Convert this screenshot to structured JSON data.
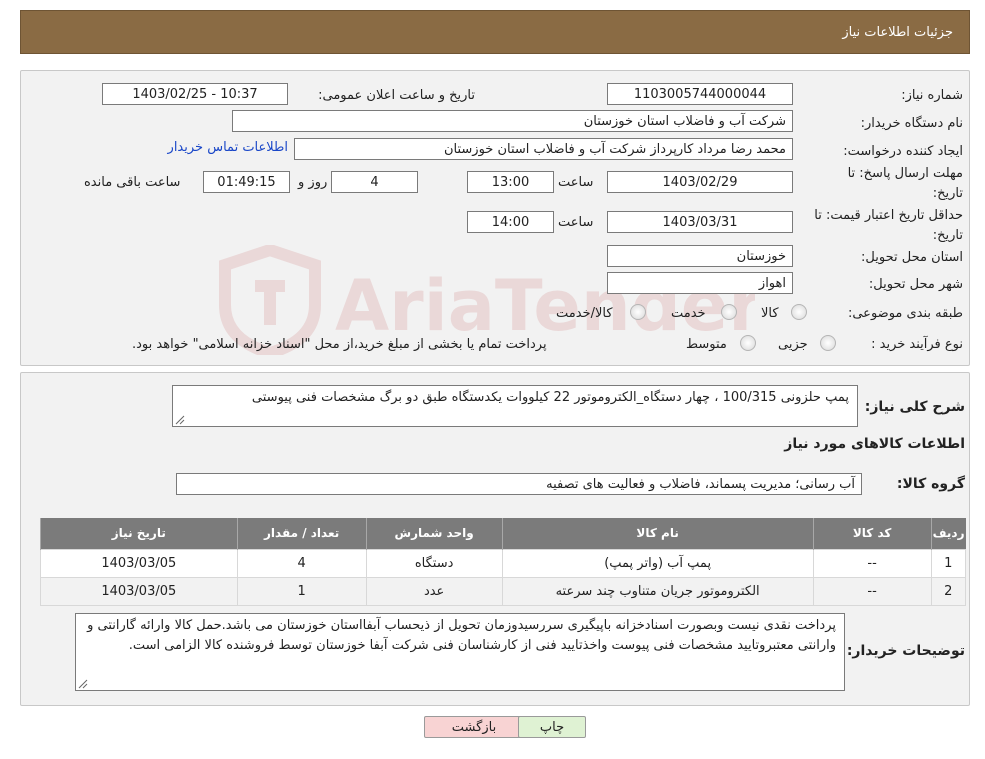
{
  "header": {
    "title": "جزئیات اطلاعات نیاز"
  },
  "form": {
    "need_number": {
      "label": "شماره نیاز:",
      "value": "1103005744000044"
    },
    "announce": {
      "label": "تاریخ و ساعت اعلان عمومی:",
      "value": "1403/02/25 - 10:37"
    },
    "buyer": {
      "label": "نام دستگاه خریدار:",
      "value": "شرکت آب و فاضلاب استان خوزستان"
    },
    "creator": {
      "label": "ایجاد کننده درخواست:",
      "value": "محمد رضا مرداد کارپرداز شرکت آب و فاضلاب استان خوزستان",
      "contact_link": "اطلاعات تماس خریدار"
    },
    "reply_deadline": {
      "label": "مهلت ارسال پاسخ: تا تاریخ:",
      "date": "1403/02/29",
      "time_label": "ساعت",
      "time": "13:00",
      "days": "4",
      "days_label": "روز و",
      "remaining": "01:49:15",
      "remaining_label": "ساعت باقی مانده"
    },
    "price_validity": {
      "label": "حداقل تاریخ اعتبار قیمت: تا تاریخ:",
      "date": "1403/03/31",
      "time_label": "ساعت",
      "time": "14:00"
    },
    "province": {
      "label": "استان محل تحویل:",
      "value": "خوزستان"
    },
    "city": {
      "label": "شهر محل تحویل:",
      "value": "اهواز"
    },
    "category": {
      "label": "طبقه بندی موضوعی:",
      "options": [
        "کالا",
        "خدمت",
        "کالا/خدمت"
      ]
    },
    "purchase_type": {
      "label": "نوع فرآیند خرید :",
      "options": [
        "جزیی",
        "متوسط"
      ],
      "note": "پرداخت تمام یا بخشی از مبلغ خرید،از محل \"اسناد خزانه اسلامی\" خواهد بود."
    }
  },
  "description": {
    "label": "شرح کلی نیاز:",
    "value": "پمپ حلزونی 100/315 ، چهار دستگاه_الکتروموتور 22 کیلووات یکدستگاه طبق دو برگ مشخصات فنی پیوستی"
  },
  "goods": {
    "section_title": "اطلاعات کالاهای مورد نیاز",
    "group_label": "گروه کالا:",
    "group_value": "آب رسانی؛ مدیریت پسماند، فاضلاب و فعالیت های تصفیه",
    "columns": [
      "ردیف",
      "کد کالا",
      "نام کالا",
      "واحد شمارش",
      "تعداد / مقدار",
      "تاریخ نیاز"
    ],
    "rows": [
      [
        "1",
        "--",
        "پمپ آب (واتر پمپ)",
        "دستگاه",
        "4",
        "1403/03/05"
      ],
      [
        "2",
        "--",
        "الکتروموتور جریان متناوب چند سرعته",
        "عدد",
        "1",
        "1403/03/05"
      ]
    ]
  },
  "buyer_notes": {
    "label": "توضیحات خریدار:",
    "value": "پرداخت نقدی نیست وبصورت اسنادخزانه باپیگیری سررسیدوزمان تحویل از ذیحساب آبفااستان خوزستان می باشد.حمل کالا وارائه گارانتی و وارانتی معتبروتایید مشخصات فنی پیوست واخذتایید فنی از کارشناسان فنی شرکت آبفا خوزستان توسط فروشنده کالا الزامی است."
  },
  "buttons": {
    "print": "چاپ",
    "back": "بازگشت"
  },
  "watermark": {
    "text": "AriaTender.neT",
    "color": "#b22222"
  }
}
